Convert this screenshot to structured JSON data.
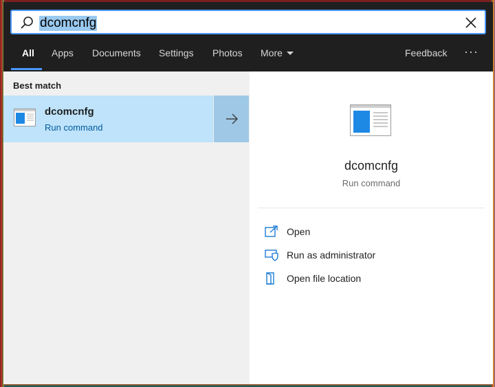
{
  "search": {
    "query": "dcomcnfg"
  },
  "tabs": [
    {
      "label": "All",
      "active": true
    },
    {
      "label": "Apps"
    },
    {
      "label": "Documents"
    },
    {
      "label": "Settings"
    },
    {
      "label": "Photos"
    },
    {
      "label": "More"
    }
  ],
  "header": {
    "feedback_label": "Feedback",
    "more_options": "···"
  },
  "results": {
    "section_heading": "Best match",
    "best_match": {
      "title": "dcomcnfg",
      "subtitle": "Run command"
    }
  },
  "details": {
    "title": "dcomcnfg",
    "subtitle": "Run command",
    "actions": [
      {
        "label": "Open",
        "icon": "open-icon"
      },
      {
        "label": "Run as administrator",
        "icon": "shield-icon"
      },
      {
        "label": "Open file location",
        "icon": "folder-icon"
      }
    ]
  },
  "colors": {
    "accent": "#4b97ff",
    "selection": "#bee3fa",
    "header_bg": "#1f1f1f"
  }
}
